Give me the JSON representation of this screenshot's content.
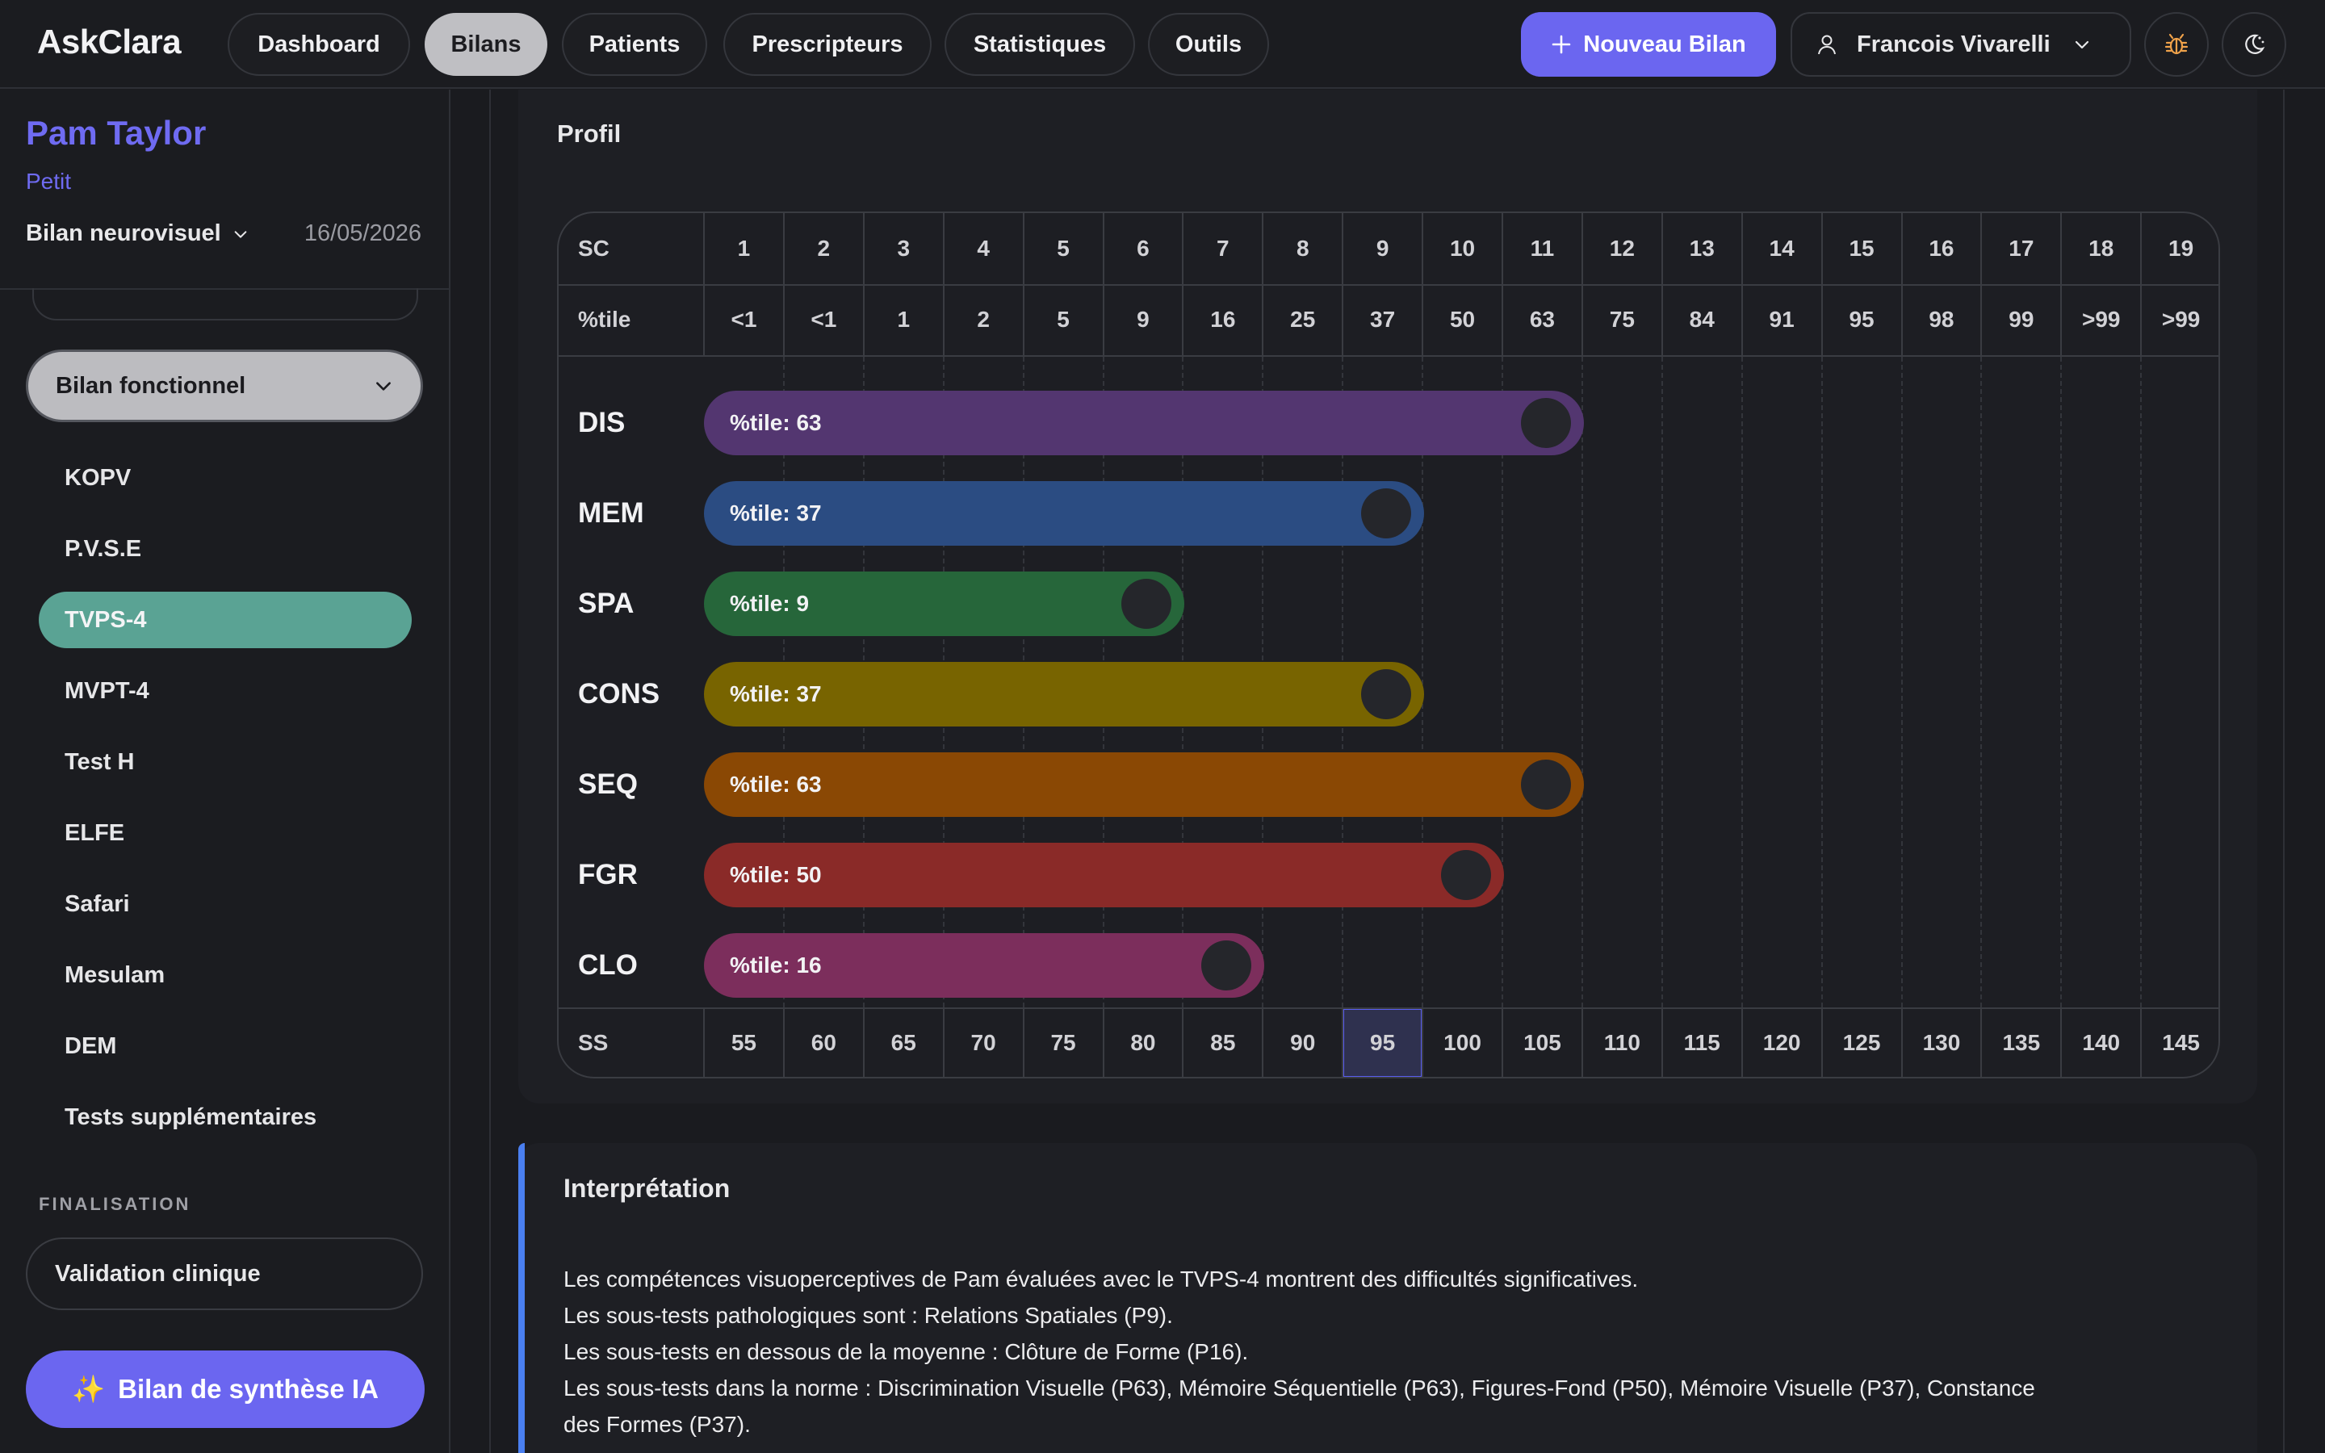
{
  "app": {
    "logo": "AskClara"
  },
  "nav": {
    "items": [
      "Dashboard",
      "Bilans",
      "Patients",
      "Prescripteurs",
      "Statistiques",
      "Outils"
    ],
    "active": "Bilans"
  },
  "header": {
    "new_bilan_label": "Nouveau Bilan",
    "user_name": "Francois Vivarelli"
  },
  "patient": {
    "name": "Pam Taylor",
    "subtitle": "Petit",
    "bilan_type": "Bilan neurovisuel",
    "date": "16/05/2026"
  },
  "sidebar": {
    "section_dropdown": "Bilan fonctionnel",
    "items": [
      "KOPV",
      "P.V.S.E",
      "TVPS-4",
      "MVPT-4",
      "Test H",
      "ELFE",
      "Safari",
      "Mesulam",
      "DEM",
      "Tests supplémentaires"
    ],
    "active_item": "TVPS-4",
    "finalisation_label": "FINALISATION",
    "validation_label": "Validation clinique",
    "ia_button_label": "Bilan de synthèse IA",
    "ia_icon": "✨"
  },
  "profil": {
    "title": "Profil",
    "sc_label": "SC",
    "sc_values": [
      "1",
      "2",
      "3",
      "4",
      "5",
      "6",
      "7",
      "8",
      "9",
      "10",
      "11",
      "12",
      "13",
      "14",
      "15",
      "16",
      "17",
      "18",
      "19"
    ],
    "percentile_label": "%tile",
    "percentile_values": [
      "<1",
      "<1",
      "1",
      "2",
      "5",
      "9",
      "16",
      "25",
      "37",
      "50",
      "63",
      "75",
      "84",
      "91",
      "95",
      "98",
      "99",
      ">99",
      ">99"
    ],
    "ss_label": "SS",
    "ss_values": [
      "55",
      "60",
      "65",
      "70",
      "75",
      "80",
      "85",
      "90",
      "95",
      "100",
      "105",
      "110",
      "115",
      "120",
      "125",
      "130",
      "135",
      "140",
      "145"
    ],
    "highlighted_ss": "95",
    "bars": [
      {
        "label": "DIS",
        "text": "%tile: 63",
        "sc": 11,
        "color": "#533670"
      },
      {
        "label": "MEM",
        "text": "%tile: 37",
        "sc": 9,
        "color": "#2b4c82"
      },
      {
        "label": "SPA",
        "text": "%tile: 9",
        "sc": 6,
        "color": "#26663a"
      },
      {
        "label": "CONS",
        "text": "%tile: 37",
        "sc": 9,
        "color": "#786400"
      },
      {
        "label": "SEQ",
        "text": "%tile: 63",
        "sc": 11,
        "color": "#8a4804"
      },
      {
        "label": "FGR",
        "text": "%tile: 50",
        "sc": 10,
        "color": "#8a2a28"
      },
      {
        "label": "CLO",
        "text": "%tile: 16",
        "sc": 7,
        "color": "#7c2e5c"
      }
    ]
  },
  "interpretation": {
    "title": "Interprétation",
    "lines": [
      "Les compétences visuoperceptives de Pam évaluées avec le TVPS-4 montrent des difficultés significatives.",
      "Les sous-tests pathologiques sont : Relations Spatiales (P9).",
      "Les sous-tests en dessous de la moyenne : Clôture de Forme (P16).",
      "Les sous-tests dans la norme : Discrimination Visuelle (P63), Mémoire Séquentielle (P63), Figures-Fond (P50), Mémoire Visuelle (P37), Constance",
      "des Formes (P37)."
    ]
  }
}
